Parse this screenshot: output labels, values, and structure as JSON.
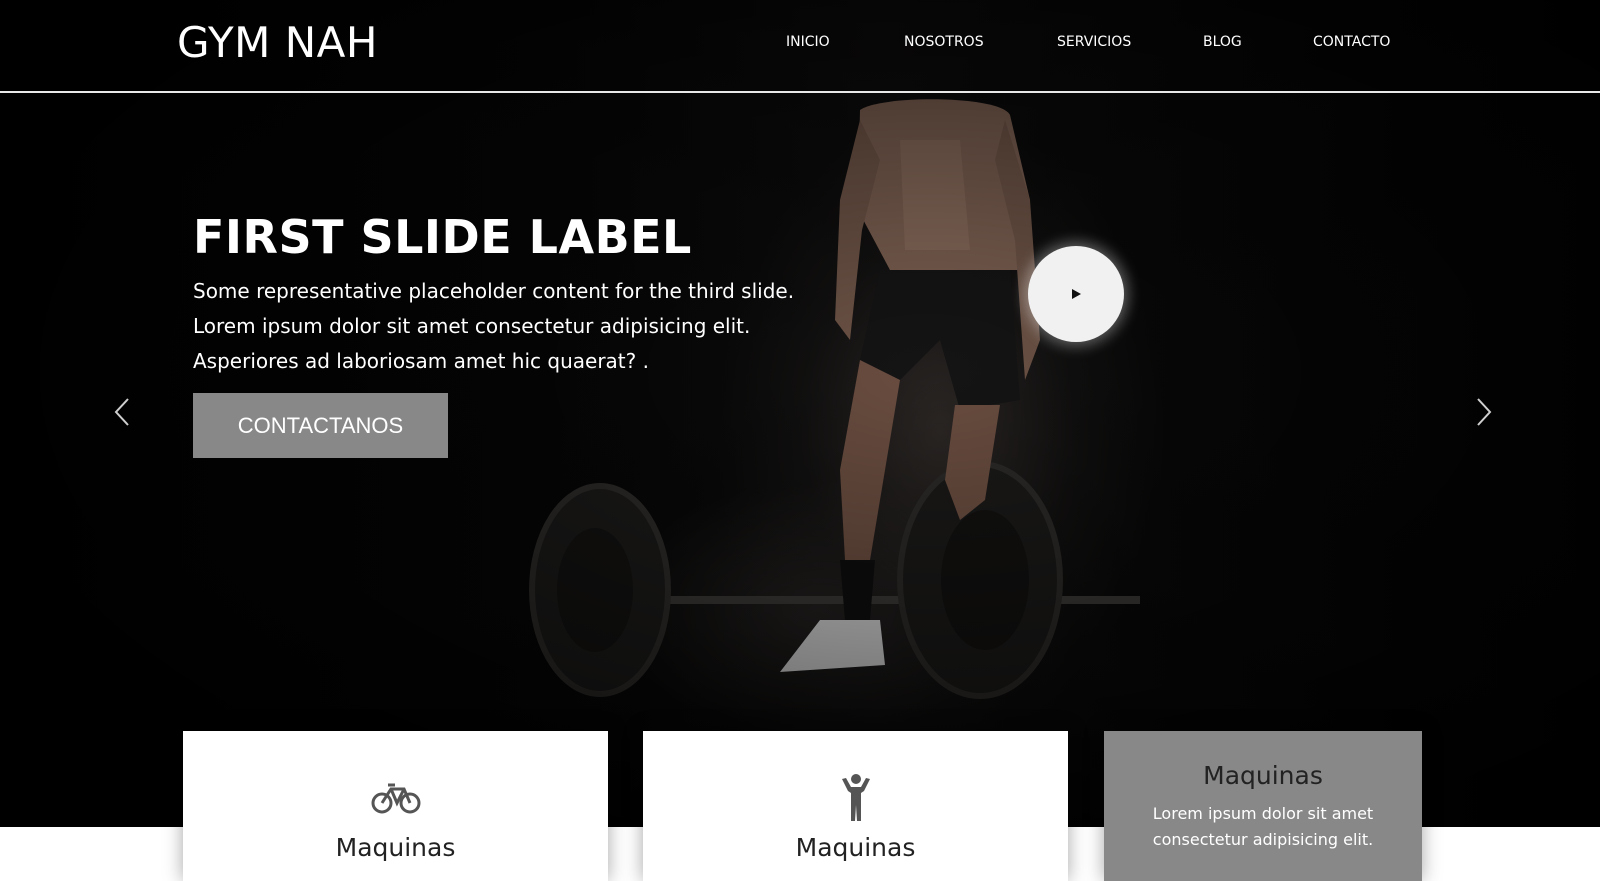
{
  "navbar": {
    "brand": "GYM NAH",
    "links": [
      {
        "label": "INICIO"
      },
      {
        "label": "NOSOTROS"
      },
      {
        "label": "SERVICIOS"
      },
      {
        "label": "BLOG"
      },
      {
        "label": "CONTACTO"
      }
    ]
  },
  "hero": {
    "title": "FIRST SLIDE LABEL",
    "lines": [
      "Some representative placeholder content for the third slide.",
      "Lorem ipsum dolor sit amet consectetur adipisicing elit.",
      "Asperiores ad laboriosam amet hic quaerat? ."
    ],
    "cta_label": "CONTACTANOS",
    "play_icon": "play-icon",
    "prev_icon": "chevron-left-icon",
    "next_icon": "chevron-right-icon"
  },
  "cards": [
    {
      "icon": "bicycle-icon",
      "title": "Maquinas"
    },
    {
      "icon": "person-icon",
      "title": "Maquinas"
    },
    {
      "title": "Maquinas",
      "text_lines": [
        "Lorem ipsum dolor sit amet",
        "consectetur adipisicing elit."
      ]
    }
  ],
  "colors": {
    "cta_bg": "#888888",
    "highlight_card_bg": "#888888",
    "nav_divider": "#e8e8e8"
  }
}
